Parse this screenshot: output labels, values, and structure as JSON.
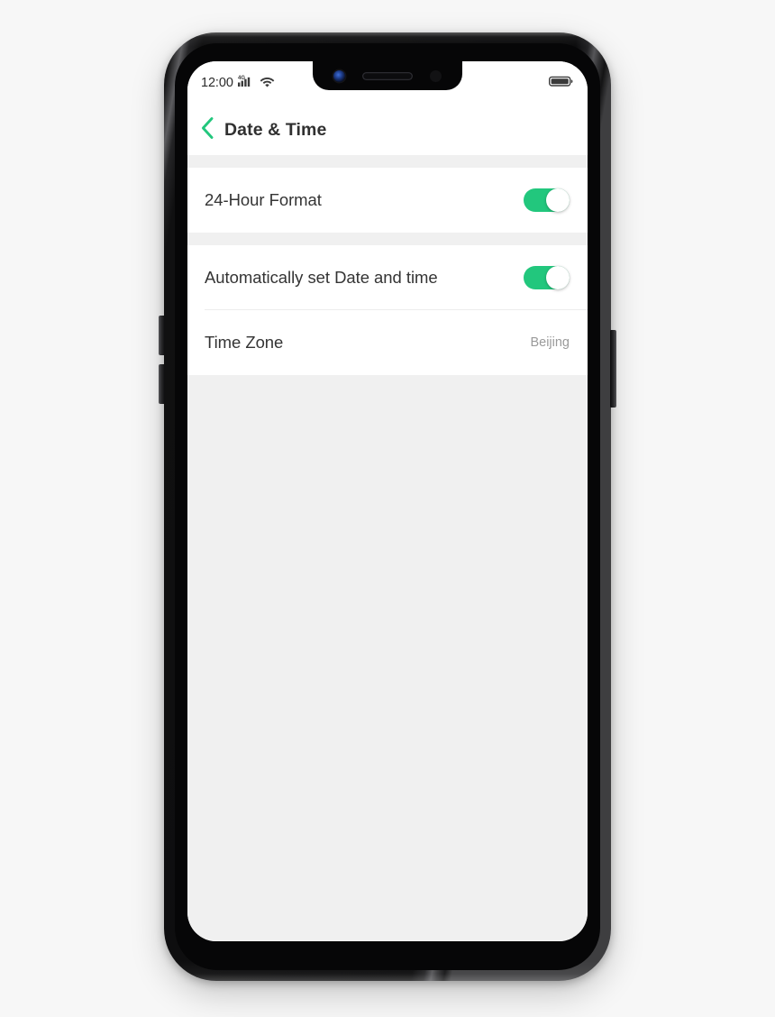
{
  "device": {
    "name": "oppo-smartphone-mockup",
    "frame_color": "#151517",
    "notch": {
      "camera_icon": "front-camera-icon",
      "speaker_icon": "earpiece-speaker-icon",
      "sensor_icon": "proximity-sensor-icon"
    },
    "buttons": {
      "volume_up": "volume-up-button",
      "volume_down": "volume-down-button",
      "power": "power-button"
    }
  },
  "status_bar": {
    "time": "12:00",
    "signal_icon": "cellular-signal-4g-icon",
    "wifi_icon": "wifi-icon",
    "battery_icon": "battery-full-icon"
  },
  "title_bar": {
    "back_icon": "back-chevron-icon",
    "title": "Date & Time"
  },
  "settings": {
    "groups": [
      {
        "rows": [
          {
            "label": "24-Hour Format",
            "control": "toggle",
            "value": "on"
          }
        ]
      },
      {
        "rows": [
          {
            "label": "Automatically set Date and time",
            "control": "toggle",
            "value": "on"
          },
          {
            "label": "Time Zone",
            "control": "value",
            "value": "Beijing"
          }
        ]
      }
    ]
  },
  "navigation_bar": {
    "recents_label": "recents-button",
    "home_label": "home-button",
    "back_label": "back-button"
  },
  "colors": {
    "accent_green": "#22c77d",
    "page_background": "#f0f0f0",
    "card_background": "#ffffff",
    "primary_text": "#343434",
    "secondary_text": "#9a9a9a"
  }
}
